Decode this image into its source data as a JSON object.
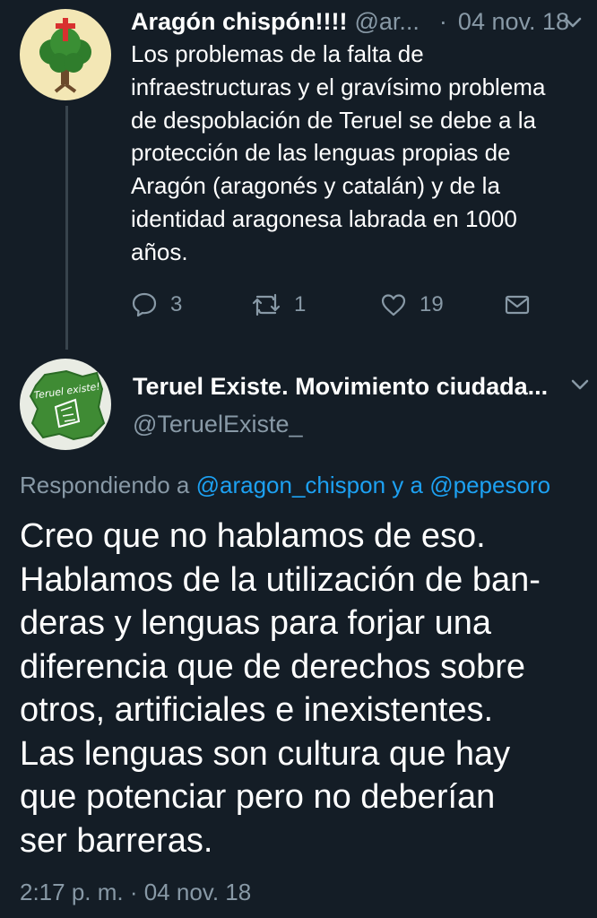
{
  "parent_tweet": {
    "author_name": "Aragón chispón!!!!",
    "author_handle": "@ar...",
    "separator": "·",
    "date": "04 nov. 18",
    "avatar_icon": "tree-with-cross-avatar",
    "body_lines": [
      "Los problemas de la falta de",
      "infraestructuras y el gravísimo problema",
      "de despoblación de Teruel se debe a la",
      "protección de las lenguas propias de",
      "Aragón (aragonés y catalán) y de la",
      "identidad aragonesa labrada en 1000",
      "años."
    ],
    "actions": {
      "reply_count": "3",
      "retweet_count": "1",
      "like_count": "19"
    }
  },
  "main_tweet": {
    "author_name": "Teruel Existe. Movimiento ciudada...",
    "author_handle": "@TeruelExiste_",
    "avatar_text": "Teruel existe!",
    "replying_prefix": "Respondiendo a",
    "replying_mention_1": "@aragon_chispon",
    "replying_conjunction": "y a",
    "replying_mention_2": "@pepesoro",
    "body_lines": [
      "Creo que no hablamos de eso.",
      "Hablamos de la utilización de ban-",
      "deras y lenguas para forjar una",
      "diferencia que de derechos sobre",
      "otros, artificiales e inexistentes.",
      "Las lenguas son cultura que hay",
      "que potenciar pero no deberían",
      "ser barreras."
    ],
    "timestamp": "2:17 p. m. · 04 nov. 18"
  },
  "colors": {
    "background": "#141d26",
    "primary_text": "#ffffff",
    "secondary_text": "#8899a6",
    "link": "#1da1f2",
    "thread_line": "#38444d"
  }
}
